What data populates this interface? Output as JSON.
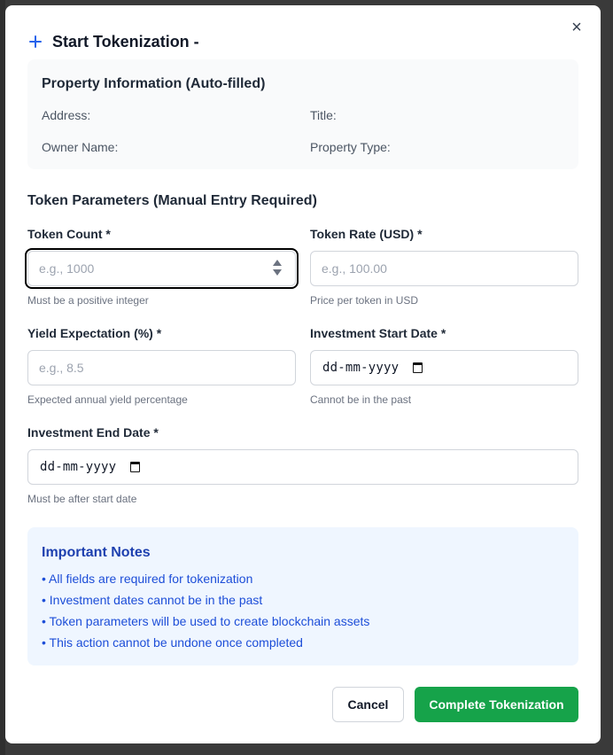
{
  "modal": {
    "title": "Start Tokenization -",
    "close_glyph": "×"
  },
  "property_info": {
    "title": "Property Information (Auto-filled)",
    "address_label": "Address:",
    "title_label": "Title:",
    "owner_label": "Owner Name:",
    "type_label": "Property Type:"
  },
  "token_params": {
    "title": "Token Parameters (Manual Entry Required)",
    "token_count": {
      "label": "Token Count *",
      "placeholder": "e.g., 1000",
      "value": "",
      "help": "Must be a positive integer"
    },
    "token_rate": {
      "label": "Token Rate (USD) *",
      "placeholder": "e.g., 100.00",
      "value": "",
      "help": "Price per token in USD"
    },
    "yield": {
      "label": "Yield Expectation (%) *",
      "placeholder": "e.g., 8.5",
      "value": "",
      "help": "Expected annual yield percentage"
    },
    "start_date": {
      "label": "Investment Start Date *",
      "value": "dd-mm-yyyy",
      "help": "Cannot be in the past"
    },
    "end_date": {
      "label": "Investment End Date *",
      "value": "dd-mm-yyyy",
      "help": "Must be after start date"
    }
  },
  "notes": {
    "title": "Important Notes",
    "items": [
      "• All fields are required for tokenization",
      "• Investment dates cannot be in the past",
      "• Token parameters will be used to create blockchain assets",
      "• This action cannot be undone once completed"
    ]
  },
  "actions": {
    "cancel_label": "Cancel",
    "submit_label": "Complete Tokenization"
  },
  "colors": {
    "accent": "#2563eb",
    "primary_button": "#16a34a",
    "notes_text": "#1d4ed8"
  }
}
